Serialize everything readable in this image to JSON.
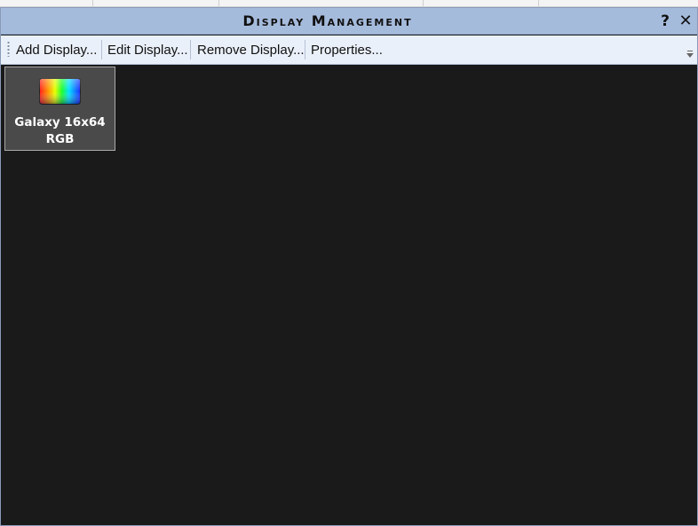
{
  "window": {
    "title": "Display Management",
    "help_label": "?",
    "close_label": "✕"
  },
  "toolbar": {
    "add_label": "Add Display...",
    "edit_label": "Edit Display...",
    "remove_label": "Remove Display...",
    "properties_label": "Properties..."
  },
  "displays": [
    {
      "name_line1": "Galaxy 16x64",
      "name_line2": "RGB",
      "icon": "rgb-display-icon"
    }
  ],
  "colors": {
    "titlebar": "#a5bbdc",
    "toolbar": "#eaf0f9",
    "canvas": "#1a1a1a",
    "tile": "#4a4a4a"
  }
}
